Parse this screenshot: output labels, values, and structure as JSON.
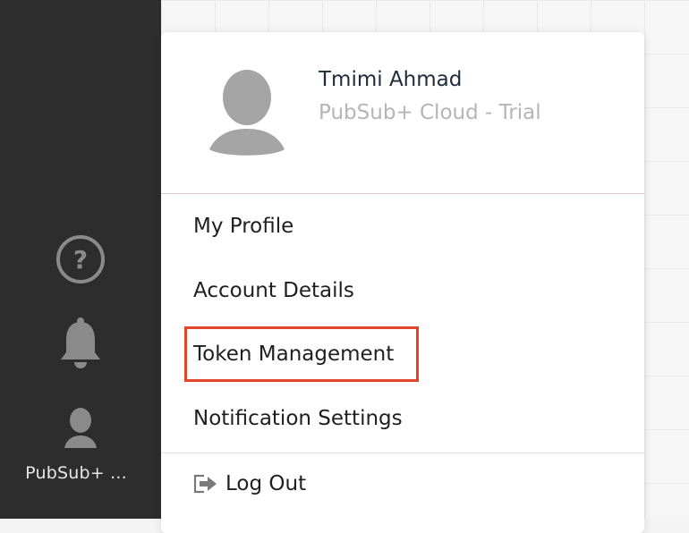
{
  "sidebar": {
    "icons": [
      "help-icon",
      "bell-icon",
      "user-icon"
    ],
    "account_label": "PubSub+ ..."
  },
  "user_menu": {
    "name": "Tmimi Ahmad",
    "plan": "PubSub+ Cloud - Trial",
    "items": [
      {
        "label": "My Profile"
      },
      {
        "label": "Account Details"
      },
      {
        "label": "Token Management",
        "highlighted": true
      },
      {
        "label": "Notification Settings"
      }
    ],
    "logout_label": "Log Out"
  },
  "colors": {
    "sidebar_bg": "#2d2d2d",
    "highlight_border": "#e0452c",
    "name_text": "#1d2b3a",
    "plan_text": "#b5b5b5"
  }
}
